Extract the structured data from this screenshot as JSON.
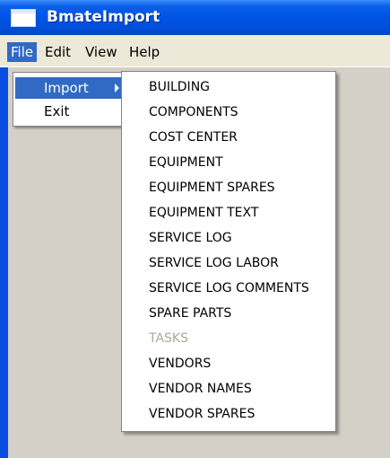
{
  "window": {
    "title": "BmateImport"
  },
  "menu_bar": {
    "items": [
      {
        "id": "file",
        "label": "File"
      },
      {
        "id": "edit",
        "label": "Edit"
      },
      {
        "id": "view",
        "label": "View"
      },
      {
        "id": "help",
        "label": "Help"
      }
    ],
    "active": "File"
  },
  "file_menu": {
    "items": [
      {
        "label": "Import",
        "has_submenu": true,
        "highlighted": true
      },
      {
        "label": "Exit",
        "has_submenu": false,
        "highlighted": false
      }
    ]
  },
  "import_submenu": {
    "items": [
      {
        "label": "BUILDING",
        "enabled": true
      },
      {
        "label": "COMPONENTS",
        "enabled": true
      },
      {
        "label": "COST CENTER",
        "enabled": true
      },
      {
        "label": "EQUIPMENT",
        "enabled": true
      },
      {
        "label": "EQUIPMENT SPARES",
        "enabled": true
      },
      {
        "label": "EQUIPMENT TEXT",
        "enabled": true
      },
      {
        "label": "SERVICE LOG",
        "enabled": true
      },
      {
        "label": "SERVICE LOG LABOR",
        "enabled": true
      },
      {
        "label": "SERVICE LOG COMMENTS",
        "enabled": true
      },
      {
        "label": "SPARE PARTS",
        "enabled": true
      },
      {
        "label": "TASKS",
        "enabled": false
      },
      {
        "label": "VENDORS",
        "enabled": true
      },
      {
        "label": "VENDOR NAMES",
        "enabled": true
      },
      {
        "label": "VENDOR SPARES",
        "enabled": true
      }
    ]
  },
  "colors": {
    "title_bar": "#0055e5",
    "menu_bar": "#ece9d8",
    "client_area": "#d4d0c8",
    "highlight": "#316ac5",
    "disabled_text": "#aca899"
  },
  "icons": {
    "app": "window-icon",
    "submenu_arrow": "triangle-right-icon"
  }
}
